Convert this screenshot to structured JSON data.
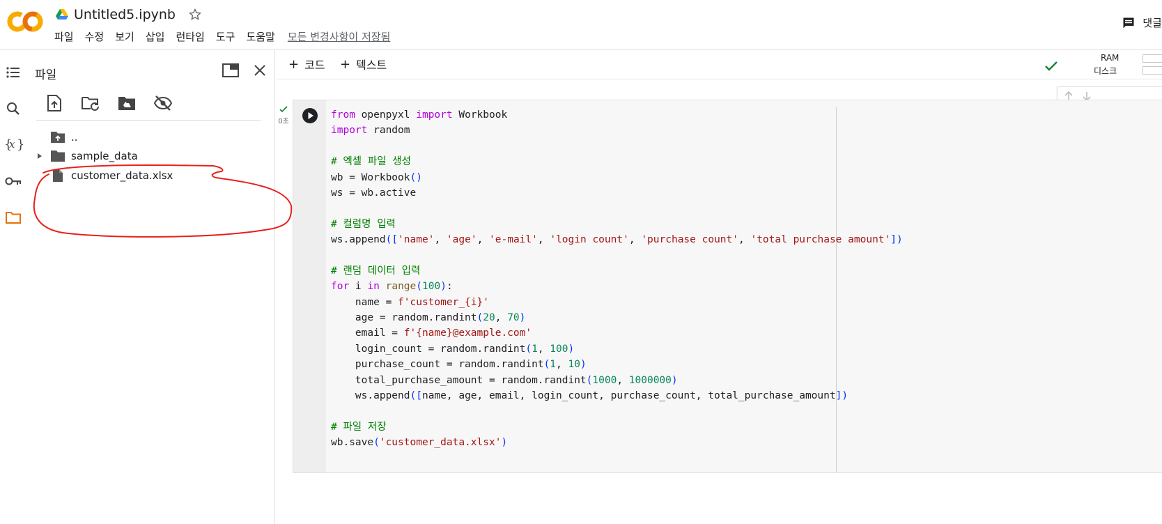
{
  "header": {
    "notebook_title": "Untitled5.ipynb",
    "menu": [
      "파일",
      "수정",
      "보기",
      "삽입",
      "런타임",
      "도구",
      "도움말"
    ],
    "saved_status": "모든 변경사항이 저장됨",
    "comment_label": "댓글"
  },
  "sidebar": {
    "panel_title": "파일",
    "tree": [
      {
        "label": "..",
        "type": "parent"
      },
      {
        "label": "sample_data",
        "type": "folder"
      },
      {
        "label": "customer_data.xlsx",
        "type": "file"
      }
    ]
  },
  "toolbar": {
    "add_code": "코드",
    "add_text": "텍스트",
    "ram_label": "RAM",
    "disk_label": "디스크"
  },
  "cell": {
    "exec_time": "0초",
    "code_lines": [
      "from openpyxl import Workbook",
      "import random",
      "",
      "# 엑셀 파일 생성",
      "wb = Workbook()",
      "ws = wb.active",
      "",
      "# 컬럼명 입력",
      "ws.append(['name', 'age', 'e-mail', 'login count', 'purchase count', 'total purchase amount'])",
      "",
      "# 랜덤 데이터 입력",
      "for i in range(100):",
      "    name = f'customer_{i}'",
      "    age = random.randint(20, 70)",
      "    email = f'{name}@example.com'",
      "    login_count = random.randint(1, 100)",
      "    purchase_count = random.randint(1, 10)",
      "    total_purchase_amount = random.randint(1000, 1000000)",
      "    ws.append([name, age, email, login_count, purchase_count, total_purchase_amount])",
      "",
      "# 파일 저장",
      "wb.save('customer_data.xlsx')"
    ]
  },
  "colors": {
    "logo_orange": "#F9AB00",
    "annotation_red": "#E8201A",
    "keyword_purple": "#AF00DB",
    "string_red": "#A31515",
    "comment_green": "#008000",
    "number_green": "#098658"
  }
}
